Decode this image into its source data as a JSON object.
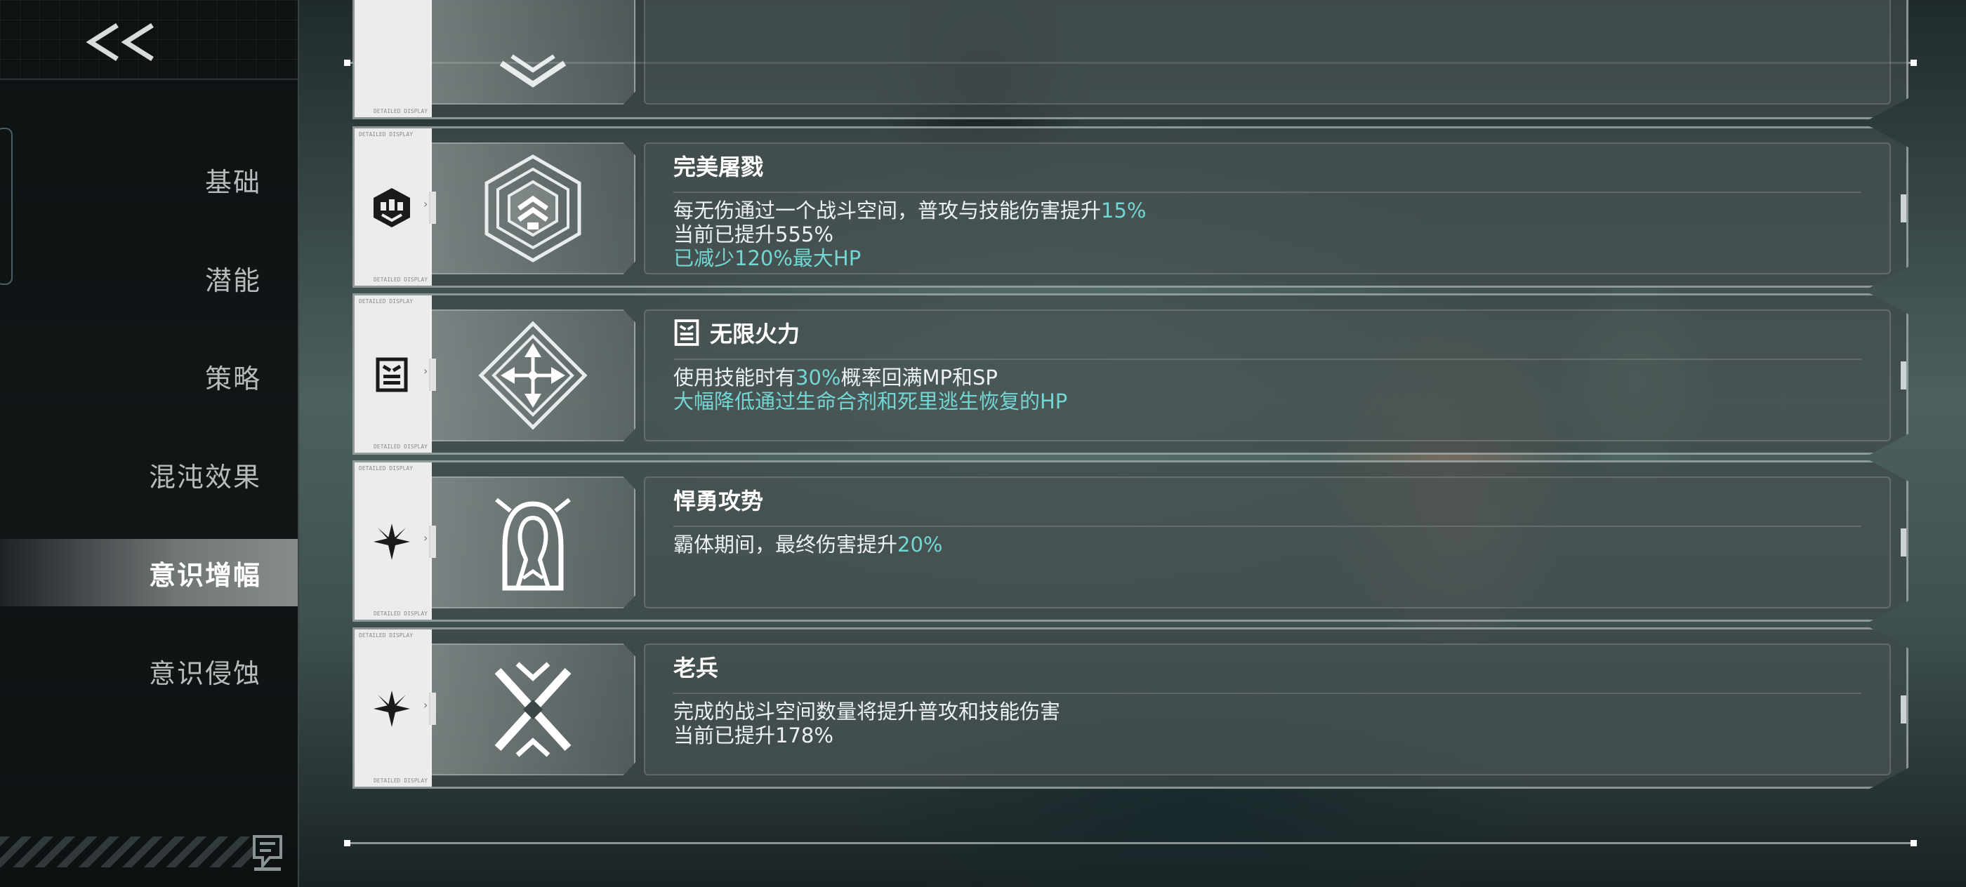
{
  "colors": {
    "highlight": "#72d6d2",
    "sidebar_bg": "#0c1011",
    "card_strip": "#ececec"
  },
  "sidebar": {
    "back_icon": "double-chevron-left-icon",
    "items": [
      {
        "label": "基础",
        "active": false
      },
      {
        "label": "潜能",
        "active": false
      },
      {
        "label": "策略",
        "active": false
      },
      {
        "label": "混沌效果",
        "active": false
      },
      {
        "label": "意识增幅",
        "active": true
      },
      {
        "label": "意识侵蚀",
        "active": false
      }
    ],
    "chat_icon": "chat-bubble-icon"
  },
  "strip_caption": "DETAILED DISPLAY",
  "cards": [
    {
      "title": "完美屠戮",
      "type_icon": "hexagon-helmet-icon",
      "main_icon": "hexagon-chevron-emblem-icon",
      "lines": [
        {
          "a": "每无伤通过一个战斗空间，普攻与技能伤害提升",
          "b": "15%",
          "style": "mixed"
        },
        {
          "a": "当前已提升555%",
          "style": "plain"
        },
        {
          "a": "已减少120%最大HP",
          "style": "accent"
        }
      ]
    },
    {
      "title": "无限火力",
      "title_icon": "angry-box-icon",
      "type_icon": "angry-box-icon",
      "main_icon": "diamond-four-arrows-icon",
      "lines": [
        {
          "a": "使用技能时有",
          "b": "30%",
          "c": "概率回满MP和SP",
          "style": "mixed"
        },
        {
          "a": "大幅降低通过生命合剂和死里逃生恢复的HP",
          "style": "accent"
        }
      ]
    },
    {
      "title": "悍勇攻势",
      "type_icon": "four-point-star-icon",
      "main_icon": "hooded-figure-icon",
      "lines": [
        {
          "a": "霸体期间，最终伤害提升",
          "b": "20%",
          "style": "mixed"
        }
      ]
    },
    {
      "title": "老兵",
      "type_icon": "four-point-star-icon",
      "main_icon": "crossed-swords-icon",
      "lines": [
        {
          "a": "完成的战斗空间数量将提升普攻和技能伤害",
          "style": "plain"
        },
        {
          "a": "当前已提升178%",
          "style": "plain"
        }
      ]
    }
  ]
}
